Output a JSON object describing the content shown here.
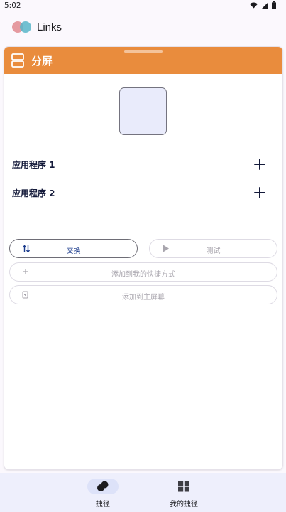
{
  "status_bar": {
    "time": "5:02",
    "icons": [
      "wifi-icon",
      "signal-icon",
      "battery-icon"
    ]
  },
  "app_bar": {
    "title": "Links",
    "logo_colors": [
      "#e59aa0",
      "#58b6c9"
    ]
  },
  "card": {
    "header_color": "#e98c3d",
    "title": "分屏",
    "header_icon": "split-screen-icon",
    "app_rows": [
      {
        "label": "应用程序 1",
        "action_icon": "plus-icon"
      },
      {
        "label": "应用程序 2",
        "action_icon": "plus-icon"
      }
    ],
    "buttons": {
      "swap": {
        "label": "交换",
        "icon": "swap-vertical-icon",
        "enabled": true
      },
      "test": {
        "label": "测试",
        "icon": "play-icon",
        "enabled": false
      },
      "add_shortcut": {
        "label": "添加到我的快捷方式",
        "icon": "plus-icon",
        "enabled": false
      },
      "add_home": {
        "label": "添加到主屏幕",
        "icon": "add-to-home-icon",
        "enabled": false
      }
    }
  },
  "bottom_nav": {
    "items": [
      {
        "label": "捷径",
        "icon": "shortcuts-icon",
        "active": true
      },
      {
        "label": "我的捷径",
        "icon": "grid-icon",
        "active": false
      }
    ]
  },
  "colors": {
    "accent": "#e98c3d",
    "primary_text": "#141a3a",
    "nav_background": "#eeeffc"
  }
}
